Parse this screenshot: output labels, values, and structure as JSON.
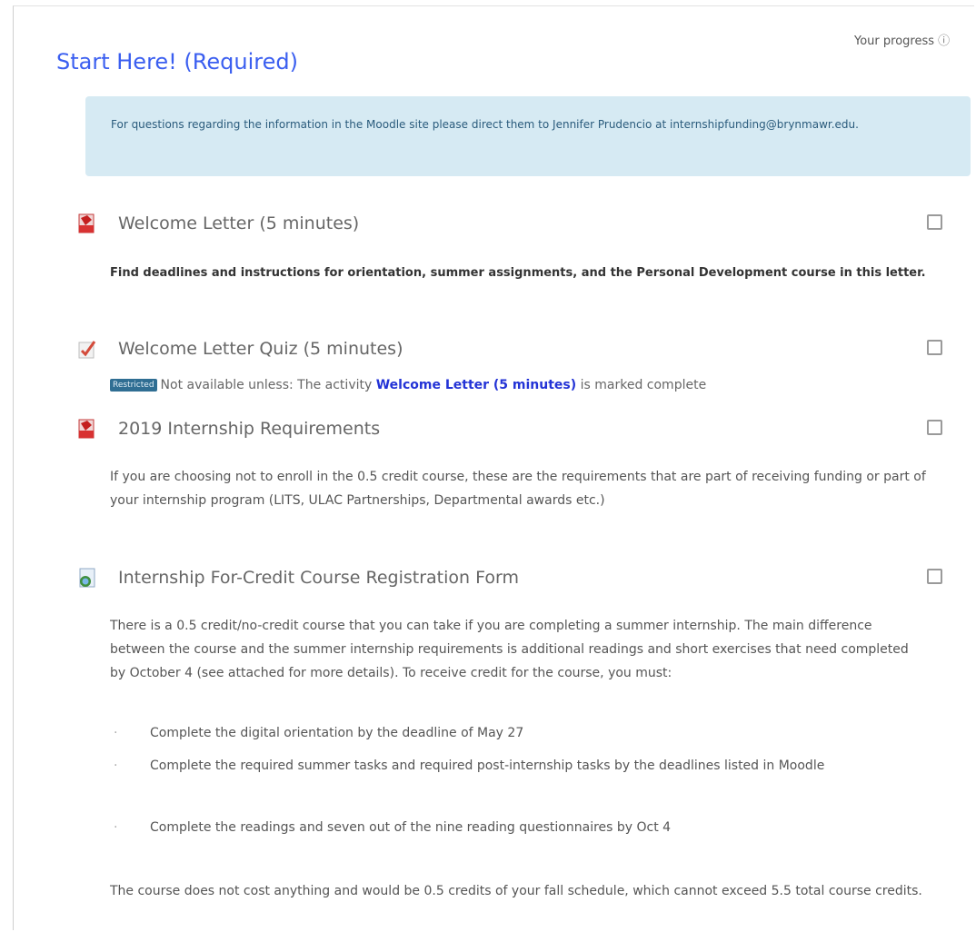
{
  "progress_label": "Your progress",
  "progress_icon": "info-icon",
  "section": {
    "title": "Start Here! (Required)"
  },
  "notice": {
    "text": "For questions regarding the information in the Moodle site please direct them to Jennifer Prudencio at internshipfunding@brynmawr.edu."
  },
  "activities": [
    {
      "name": "Welcome Letter (5 minutes)",
      "icon": "pdf-icon",
      "description": "Find deadlines and instructions for orientation, summer assignments, and the Personal Development course in this letter."
    },
    {
      "name": "Welcome Letter Quiz (5 minutes)",
      "icon": "quiz-icon",
      "restriction": {
        "badge": "Restricted",
        "prefix": "Not available unless: The activity ",
        "link": "Welcome Letter (5 minutes)",
        "suffix": " is marked complete"
      }
    },
    {
      "name": "2019 Internship Requirements",
      "icon": "pdf-icon",
      "description": "If you are choosing not to enroll in the 0.5 credit course, these are the requirements that are part of receiving funding or part of your internship program (LITS, ULAC Partnerships, Departmental awards etc.)"
    },
    {
      "name": "Internship For-Credit Course Registration Form",
      "icon": "document-icon",
      "description": "There is a 0.5 credit/no-credit course that you can take if you are completing a summer internship.  The main difference between the course and the summer internship requirements is additional readings and short exercises that need completed by October 4 (see attached for more details).  To receive credit for the course, you must:",
      "bullets": [
        "Complete the digital orientation by the deadline of May 27",
        "Complete the required summer tasks and required post-internship tasks by the deadlines listed in Moodle",
        "Complete the readings and seven out of the nine reading questionnaires by Oct 4"
      ],
      "footer": "The course does not cost anything and would be 0.5 credits of your fall schedule, which cannot exceed 5.5 total course credits."
    }
  ],
  "bullet_glyph": "·"
}
